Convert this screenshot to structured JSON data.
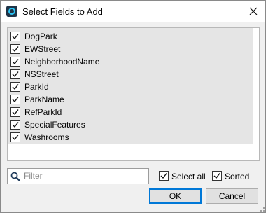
{
  "window": {
    "title": "Select Fields to Add"
  },
  "fields": [
    {
      "label": "DogPark",
      "checked": true
    },
    {
      "label": "EWStreet",
      "checked": true
    },
    {
      "label": "NeighborhoodName",
      "checked": true
    },
    {
      "label": "NSStreet",
      "checked": true
    },
    {
      "label": "ParkId",
      "checked": true
    },
    {
      "label": "ParkName",
      "checked": true
    },
    {
      "label": "RefParkId",
      "checked": true
    },
    {
      "label": "SpecialFeatures",
      "checked": true
    },
    {
      "label": "Washrooms",
      "checked": true
    }
  ],
  "filter": {
    "placeholder": "Filter",
    "value": ""
  },
  "options": {
    "select_all": {
      "label": "Select all",
      "checked": true
    },
    "sorted": {
      "label": "Sorted",
      "checked": true
    }
  },
  "buttons": {
    "ok": "OK",
    "cancel": "Cancel"
  },
  "colors": {
    "accent": "#0078d7",
    "list_fill": "#e5e5e5",
    "dialog_bg": "#f0f0f0"
  },
  "icons": {
    "app": "app-icon",
    "close": "close-icon",
    "search": "search-icon",
    "check": "check-icon",
    "grip": "resize-grip-icon"
  }
}
